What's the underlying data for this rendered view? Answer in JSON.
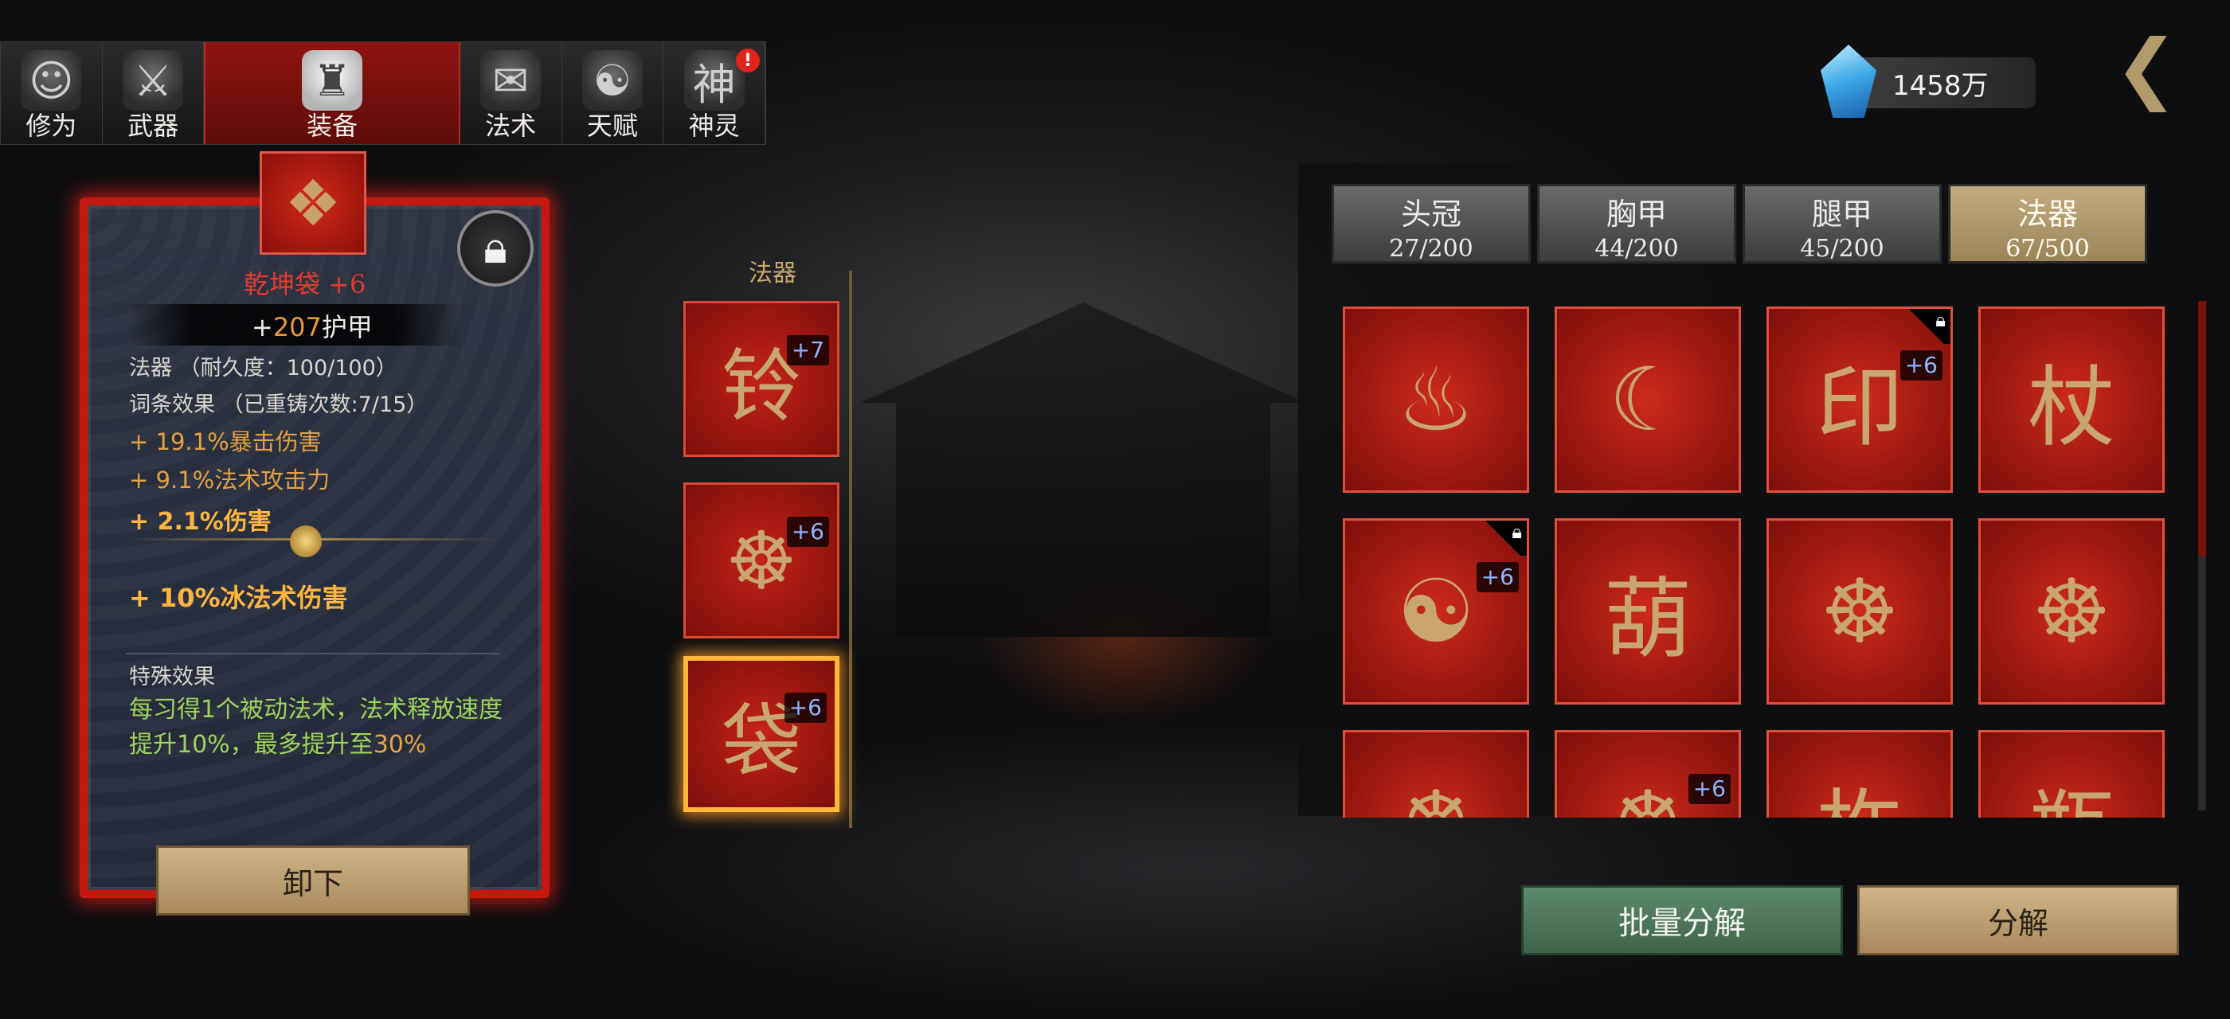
{
  "tabs": [
    {
      "label": "修为",
      "icon": "☺",
      "alert": ""
    },
    {
      "label": "武器",
      "icon": "⚔",
      "alert": ""
    },
    {
      "label": "装备",
      "icon": "♜",
      "alert": ""
    },
    {
      "label": "法术",
      "icon": "✉",
      "alert": ""
    },
    {
      "label": "天赋",
      "icon": "☯",
      "alert": ""
    },
    {
      "label": "神灵",
      "icon": "神",
      "alert": "!"
    }
  ],
  "currency": {
    "amount": "1458万"
  },
  "detail": {
    "name": "乾坤袋 +6",
    "armor_prefix": "+",
    "armor_value": "207",
    "armor_suffix": "护甲",
    "type_line": "法器 （耐久度：100/100）",
    "affix_line": "词条效果 （已重铸次数:7/15）",
    "stats": [
      "+ 19.1%暴击伤害",
      "+ 9.1%法术攻击力"
    ],
    "bonus_1": "+ 2.1%伤害",
    "bonus_2": "+ 10%冰法术伤害",
    "special_title": "特殊效果",
    "special_a": "每习得1个被动法术，法术释放速度提升10%，最多提升至",
    "special_b": "30%",
    "unequip_label": "卸下"
  },
  "equipped": {
    "header": "法器",
    "slots": [
      {
        "plus": "+7",
        "icon": "铃",
        "selected": false
      },
      {
        "plus": "+6",
        "icon": "☸",
        "selected": false
      },
      {
        "plus": "+6",
        "icon": "袋",
        "selected": true
      }
    ]
  },
  "categories": [
    {
      "name": "头冠",
      "count": "27/200",
      "active": false
    },
    {
      "name": "胸甲",
      "count": "44/200",
      "active": false
    },
    {
      "name": "腿甲",
      "count": "45/200",
      "active": false
    },
    {
      "name": "法器",
      "count": "67/500",
      "active": true
    }
  ],
  "inventory": [
    {
      "icon": "♨",
      "plus": "",
      "locked": false
    },
    {
      "icon": "☾",
      "plus": "",
      "locked": false
    },
    {
      "icon": "印",
      "plus": "+6",
      "locked": true
    },
    {
      "icon": "杖",
      "plus": "",
      "locked": false
    },
    {
      "icon": "☯",
      "plus": "+6",
      "locked": true
    },
    {
      "icon": "葫",
      "plus": "",
      "locked": false
    },
    {
      "icon": "☸",
      "plus": "",
      "locked": false
    },
    {
      "icon": "☸",
      "plus": "",
      "locked": false
    },
    {
      "icon": "☸",
      "plus": "",
      "locked": false
    },
    {
      "icon": "☸",
      "plus": "+6",
      "locked": false
    },
    {
      "icon": "杵",
      "plus": "",
      "locked": false
    },
    {
      "icon": "瓶",
      "plus": "",
      "locked": false
    }
  ],
  "buttons": {
    "batch_decompose": "批量分解",
    "decompose": "分解"
  }
}
